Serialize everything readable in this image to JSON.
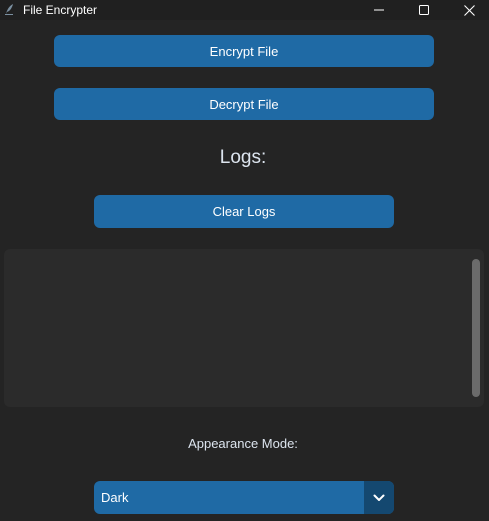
{
  "window": {
    "title": "File Encrypter",
    "icons": {
      "app": "feather-icon",
      "minimize": "minimize-icon",
      "maximize": "maximize-icon",
      "close": "close-icon"
    }
  },
  "actions": {
    "encrypt_label": "Encrypt File",
    "decrypt_label": "Decrypt File"
  },
  "logs": {
    "title": "Logs:",
    "clear_label": "Clear Logs",
    "content": ""
  },
  "appearance": {
    "label": "Appearance Mode:",
    "selected": "Dark",
    "arrow_icon": "chevron-down-icon"
  },
  "colors": {
    "background": "#242424",
    "button": "#1f6aa5",
    "button_dark": "#144870",
    "log_box": "#2b2b2b",
    "text": "#dce4ee"
  }
}
